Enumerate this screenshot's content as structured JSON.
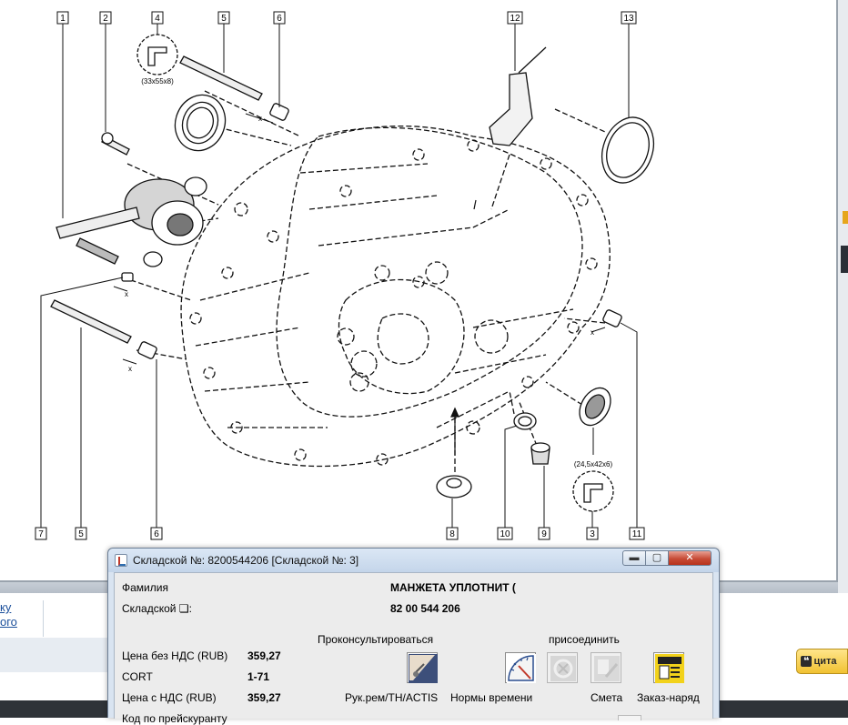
{
  "diagram": {
    "callouts": [
      {
        "id": "c1",
        "text": "1"
      },
      {
        "id": "c2",
        "text": "2"
      },
      {
        "id": "c4",
        "text": "4"
      },
      {
        "id": "c5a",
        "text": "5"
      },
      {
        "id": "c6a",
        "text": "6"
      },
      {
        "id": "c12",
        "text": "12"
      },
      {
        "id": "c13",
        "text": "13"
      },
      {
        "id": "c7",
        "text": "7"
      },
      {
        "id": "c5b",
        "text": "5"
      },
      {
        "id": "c6b",
        "text": "6"
      },
      {
        "id": "c8",
        "text": "8"
      },
      {
        "id": "c10",
        "text": "10"
      },
      {
        "id": "c9",
        "text": "9"
      },
      {
        "id": "c3",
        "text": "3"
      },
      {
        "id": "c11",
        "text": "11"
      }
    ],
    "seal_dims_top": "(33x55x8)",
    "seal_dims_bottom": "(24,5x42x6)",
    "x_marks": [
      "x",
      "x",
      "x",
      "x"
    ]
  },
  "background": {
    "left_links": [
      "ку",
      "ого"
    ],
    "quote_button_label": "цита"
  },
  "dialog": {
    "title": "Складской №: 8200544206 [Складской №: 3]",
    "min_label": "▬",
    "max_label": "▢",
    "close_label": "✕",
    "fields": {
      "family_label": "Фамилия",
      "family_value": "МАНЖЕТА УПЛОТНИТ (",
      "stock_label": "Складской ❏:",
      "stock_value": "82 00 544 206",
      "price_no_vat_label": "Цена без НДС (RUB)",
      "price_no_vat_value": "359,27",
      "cort_label": "CORT",
      "cort_value": "1-71",
      "price_vat_label": "Цена с НДС (RUB)",
      "price_vat_value": "359,27",
      "price_code_label": "Код по прейскуранту"
    },
    "actions": {
      "consult_header": "Проконсультироваться",
      "attach_header": "присоединить",
      "manual_label": "Рук.рем/TH/ACTIS",
      "labor_times_label": "Нормы времени",
      "estimate_label": "Смета",
      "work_order_label": "Заказ-наряд"
    },
    "icons": {
      "manual": "manual-book-icon",
      "labor_times": "stopwatch-gauge-icon",
      "attach_a": "disabled-part-icon",
      "estimate": "disabled-estimate-icon",
      "work_order": "work-order-icon"
    },
    "colors": {
      "title_bg": "#c4d5ea",
      "close_red": "#c74b36",
      "work_order_yellow": "#f2d21b"
    }
  }
}
